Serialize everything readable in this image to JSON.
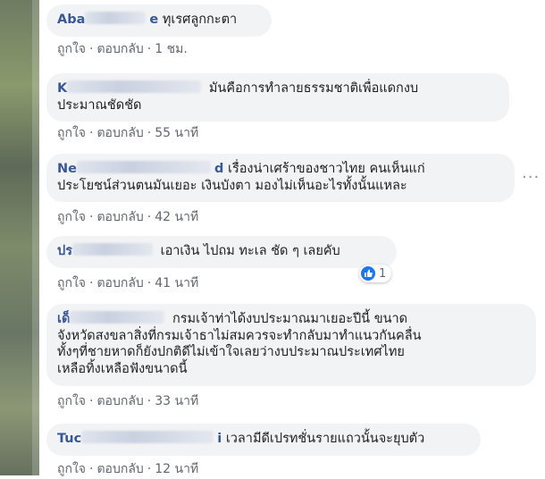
{
  "labels": {
    "like": "ถูกใจ",
    "reply": "ตอบกลับ",
    "dot": "·"
  },
  "comments": [
    {
      "name_visible": "Aba",
      "name_tail": "e",
      "text_lines": [
        "ทุเรศลูกกะตา"
      ],
      "time": "1 ชม."
    },
    {
      "name_visible": "K",
      "name_tail": "",
      "text_lines": [
        "มันคือการทำลายธรรมชาติเพื่อแดกงบ",
        "ประมาณชัดชัด"
      ],
      "time": "55 นาที"
    },
    {
      "name_visible": "Ne",
      "name_tail": "d",
      "text_lines": [
        "เรื่องน่าเศร้าของชาวไทย คนเห็นแก่",
        "ประโยชน์ส่วนตนมันเยอะ เงินบังตา มองไม่เห็นอะไรทั้งนั้นแหละ"
      ],
      "time": "42 นาที"
    },
    {
      "name_visible": "ปร",
      "name_tail": "",
      "text_lines": [
        "เอาเงิน ไปถม ทะเล ชัด ๆ เลยคับ"
      ],
      "time": "41 นาที",
      "reaction_count": "1"
    },
    {
      "name_visible": "เด็",
      "name_tail": "",
      "text_lines": [
        "กรมเจ้าท่าได้งบประมาณมาเยอะปีนี้ ขนาด",
        "จังหวัดสงขลาสิ่งที่กรมเจ้าธาไม่สมควรจะทำกลับมาทำแนวกันคลื่น",
        "ทั้งๆที่ชายหาดก็ยังปกติดีไม่เข้าใจเลยว่างบประมาณประเทศไทย",
        "เหลือทิ้งเหลือฟังขนาดนี้"
      ],
      "time": "33 นาที"
    },
    {
      "name_visible": "Tuc",
      "name_tail": "i",
      "text_lines": [
        "เวลามีดีเปรทชั่นรายแถวนั้นจะยุบตัว"
      ],
      "time": "12 นาที"
    }
  ],
  "colors": {
    "bubble": "#f2f3f5",
    "name": "#385898",
    "meta": "#606770",
    "like": "#1877f2"
  }
}
